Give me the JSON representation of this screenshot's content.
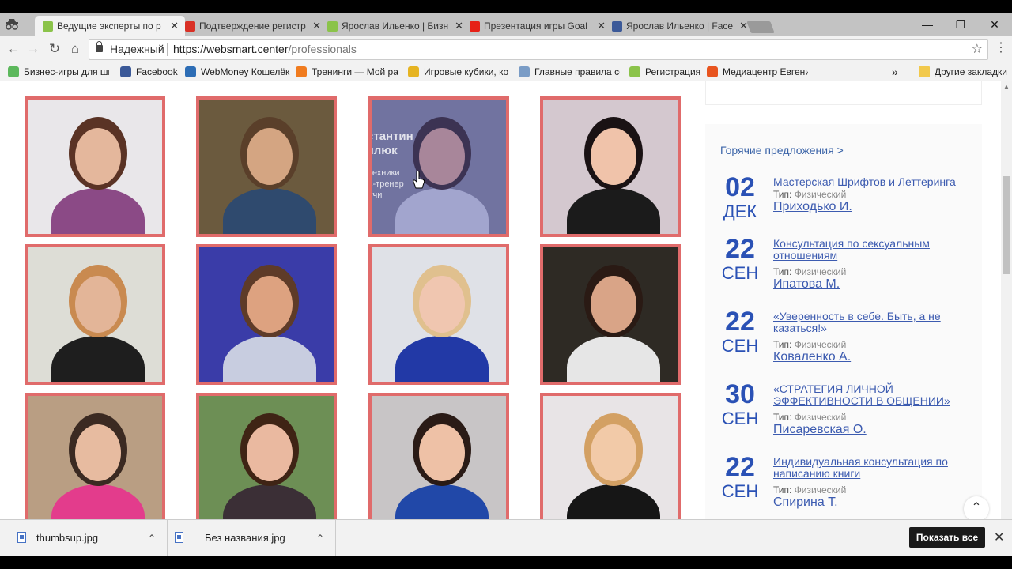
{
  "tabs": [
    {
      "title": "Ведущие эксперты по р",
      "color": "#8bc34a",
      "active": true
    },
    {
      "title": "Подтверждение регистр",
      "color": "#d93025",
      "active": false
    },
    {
      "title": "Ярослав Ильенко | Бизн",
      "color": "#8bc34a",
      "active": false
    },
    {
      "title": "Презентация игры Goal",
      "color": "#e62117",
      "active": false
    },
    {
      "title": "Ярослав Ильенко | Face",
      "color": "#3b5998",
      "active": false
    }
  ],
  "window": {
    "minimize": "—",
    "maximize": "❐",
    "close": "✕"
  },
  "toolbar": {
    "back": "←",
    "forward": "→",
    "reload": "↻",
    "home": "⌂",
    "secure_label": "Надежный",
    "url_host": "https://websmart.center",
    "url_path": "/professionals",
    "star": "☆",
    "menu": "⋮"
  },
  "bookmarks": [
    {
      "label": "Бизнес-игры для шк",
      "color": "#5cb85c"
    },
    {
      "label": "Facebook",
      "color": "#3b5998"
    },
    {
      "label": "WebMoney Кошелёк",
      "color": "#2d6db5"
    },
    {
      "label": "Тренинги — Мой ра",
      "color": "#f07b1e"
    },
    {
      "label": "Игровые кубики, ко",
      "color": "#e6b422"
    },
    {
      "label": "Главные правила со",
      "color": "#7a9cc6"
    },
    {
      "label": "Регистрация",
      "color": "#8bc34a"
    },
    {
      "label": "Медиацентр Евгени",
      "color": "#e8541e"
    }
  ],
  "bookmarks_more": "»",
  "other_bookmarks": "Другие закладки",
  "photos": [
    {
      "bg": "#e9e7ea",
      "skin": "#e4b79c",
      "hair": "#5a3325",
      "cloth": "#8b4a86"
    },
    {
      "bg": "#6b5a3e",
      "skin": "#d4a582",
      "hair": "#5a3f2a",
      "cloth": "#2f4a6e"
    },
    {
      "bg": "#8e8c96",
      "skin": "#e2a98c",
      "hair": "#3c2a20",
      "cloth": "#d9d9dc",
      "hover": true
    },
    {
      "bg": "#d4c8cf",
      "skin": "#f0c3aa",
      "hair": "#1a1214",
      "cloth": "#1b1b1b"
    },
    {
      "bg": "#ddddd6",
      "skin": "#e3b598",
      "hair": "#c98a50",
      "cloth": "#1e1e1e"
    },
    {
      "bg": "#3a3ca8",
      "skin": "#dda280",
      "hair": "#5e3b28",
      "cloth": "#c8cde0"
    },
    {
      "bg": "#dfe1e7",
      "skin": "#f0c6b0",
      "hair": "#e0c08e",
      "cloth": "#2239a6"
    },
    {
      "bg": "#2e2a24",
      "skin": "#d9a487",
      "hair": "#2a1a14",
      "cloth": "#e6e6e6"
    },
    {
      "bg": "#b99e83",
      "skin": "#e7bba0",
      "hair": "#3b2a22",
      "cloth": "#e33c8c"
    },
    {
      "bg": "#6d8f55",
      "skin": "#eab9a0",
      "hair": "#3f2415",
      "cloth": "#3b2f36"
    },
    {
      "bg": "#c8c5c6",
      "skin": "#eec1a6",
      "hair": "#2a1b16",
      "cloth": "#2148a8"
    },
    {
      "bg": "#e8e4e6",
      "skin": "#f2caa8",
      "hair": "#d3a063",
      "cloth": "#161616"
    }
  ],
  "hover_caption": {
    "name_line1": "стантин",
    "name_line2": "ялюк",
    "sub1": "техники",
    "sub2": "с-тренер",
    "sub3": "учи"
  },
  "sidebar": {
    "heading": "Горячие предложения >",
    "type_label": "Тип:",
    "events": [
      {
        "day": "02",
        "month": "ДЕК",
        "title": "Мастерская Шрифтов и Леттеринга",
        "type": "Физический",
        "author": "Приходько И."
      },
      {
        "day": "22",
        "month": "СЕН",
        "title": "Консультация по сексуальным отношениям",
        "type": "Физический",
        "author": "Ипатова М."
      },
      {
        "day": "22",
        "month": "СЕН",
        "title": "«Уверенность в себе. Быть, а не казаться!»",
        "type": "Физический",
        "author": "Коваленко А."
      },
      {
        "day": "30",
        "month": "СЕН",
        "title": "«СТРАТЕГИЯ ЛИЧНОЙ ЭФФЕКТИВНОСТИ В ОБЩЕНИИ»",
        "type": "Физический",
        "author": "Писаревская О."
      },
      {
        "day": "22",
        "month": "СЕН",
        "title": "Индивидуальная консультация по написанию книги",
        "type": "Физический",
        "author": "Спирина Т."
      }
    ]
  },
  "to_top": "⌃",
  "downloads": [
    {
      "name": "thumbsup.jpg",
      "chevron": "⌃"
    },
    {
      "name": "Без названия.jpg",
      "chevron": "⌃"
    }
  ],
  "show_all": "Показать все",
  "close_downloads": "✕"
}
